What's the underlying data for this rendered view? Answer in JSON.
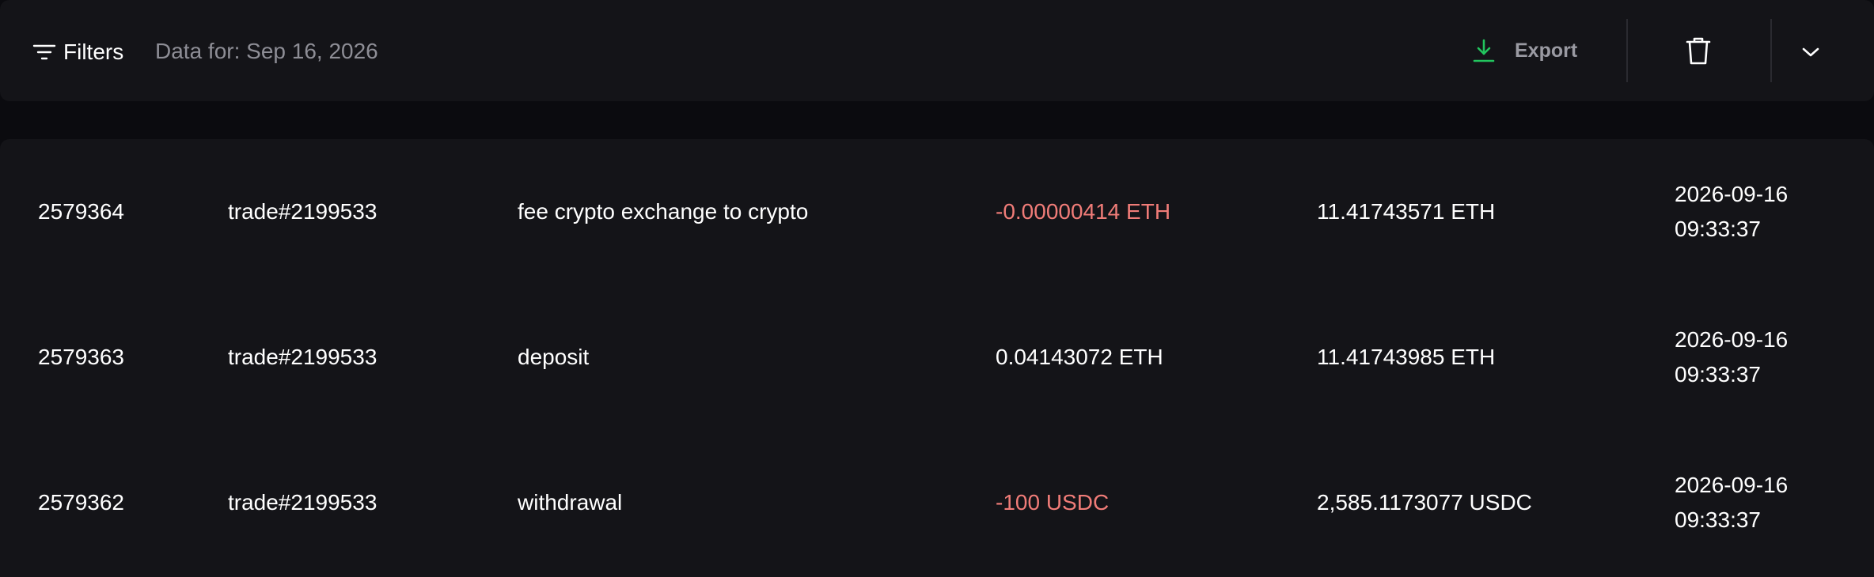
{
  "toolbar": {
    "filters_label": "Filters",
    "date_label": "Data for: Sep 16, 2026",
    "export_label": "Export",
    "icons": [
      "filter-icon",
      "download-icon",
      "trash-icon",
      "chevron-down-icon"
    ],
    "accent_color": "#22c55e"
  },
  "transactions": [
    {
      "id": "2579364",
      "ref": "trade#2199533",
      "description": "fee crypto exchange to crypto",
      "amount": "-0.00000414 ETH",
      "amount_negative": true,
      "balance": "11.41743571 ETH",
      "date": "2026-09-16",
      "time": "09:33:37"
    },
    {
      "id": "2579363",
      "ref": "trade#2199533",
      "description": "deposit",
      "amount": "0.04143072 ETH",
      "amount_negative": false,
      "balance": "11.41743985 ETH",
      "date": "2026-09-16",
      "time": "09:33:37"
    },
    {
      "id": "2579362",
      "ref": "trade#2199533",
      "description": "withdrawal",
      "amount": "-100 USDC",
      "amount_negative": true,
      "balance": "2,585.1173077 USDC",
      "date": "2026-09-16",
      "time": "09:33:37"
    }
  ],
  "colors": {
    "negative": "#f07c78",
    "text": "#ffffff",
    "muted": "#8e8e96"
  }
}
